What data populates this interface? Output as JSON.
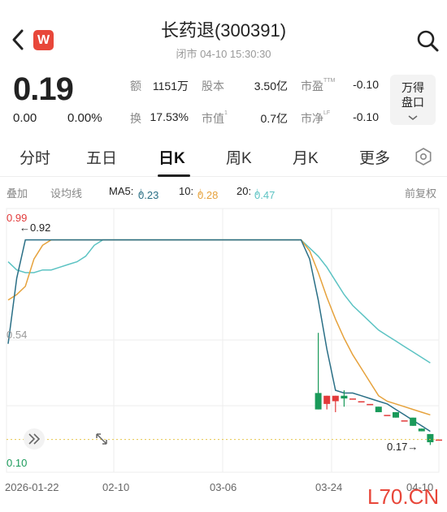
{
  "header": {
    "title": "长药退(300391)",
    "status": "闭市  04-10 15:30:30",
    "logo": "W",
    "back_icon": "chevron-left-icon",
    "search_icon": "search-icon"
  },
  "quote": {
    "price": "0.19",
    "change": "0.00",
    "change_pct": "0.00%",
    "amount_label": "额",
    "amount": "1151万",
    "turnover_label": "换",
    "turnover": "17.53%",
    "shares_label": "股本",
    "shares": "3.50亿",
    "mktcap_label": "市值",
    "mktcap_sup": "1",
    "mktcap": "0.7亿",
    "pe_label": "市盈",
    "pe_sup": "TTM",
    "pe": "-0.10",
    "pb_label": "市净",
    "pb_sup": "LF",
    "pb": "-0.10",
    "wd_line1": "万得",
    "wd_line2": "盘口",
    "wd_icon": "chevron-down-icon"
  },
  "tabs": {
    "items": [
      "分时",
      "五日",
      "日K",
      "周K",
      "月K",
      "更多"
    ],
    "active": "日K",
    "settings_icon": "gear-icon"
  },
  "indicators": {
    "overlay": "叠加",
    "set_ma": "设均线",
    "ma5_label": "MA5:",
    "ma5": "0.23",
    "ma10_label": "10:",
    "ma10": "0.28",
    "ma20_label": "20:",
    "ma20": "0.47",
    "adjust": "前复权",
    "colors": {
      "ma5": "#2a6f86",
      "ma10": "#e6a23c",
      "ma20": "#5cc3c3",
      "up": "#e23a3a",
      "down": "#1a9a5a"
    }
  },
  "chart_data": {
    "type": "candlestick",
    "y_labels": {
      "high": "0.99",
      "mid": "0.54",
      "low": "0.10"
    },
    "annotations": {
      "max": "0.92",
      "min": "0.17"
    },
    "x_labels": [
      "2026-01-22",
      "02-10",
      "03-06",
      "03-24",
      "04-10"
    ],
    "ylim": [
      0.1,
      0.99
    ],
    "last_close": 0.19,
    "ma5": [
      0.54,
      0.78,
      0.92,
      0.92,
      0.92,
      0.92,
      0.92,
      0.92,
      0.92,
      0.92,
      0.92,
      0.92,
      0.92,
      0.92,
      0.92,
      0.92,
      0.92,
      0.92,
      0.92,
      0.92,
      0.92,
      0.92,
      0.92,
      0.92,
      0.92,
      0.92,
      0.92,
      0.92,
      0.92,
      0.92,
      0.92,
      0.92,
      0.92,
      0.92,
      0.92,
      0.85,
      0.7,
      0.52,
      0.37,
      0.36,
      0.36,
      0.35,
      0.34,
      0.33,
      0.32,
      0.3,
      0.28,
      0.26,
      0.24,
      0.22
    ],
    "ma10": [
      0.7,
      0.72,
      0.75,
      0.85,
      0.9,
      0.92,
      0.92,
      0.92,
      0.92,
      0.92,
      0.92,
      0.92,
      0.92,
      0.92,
      0.92,
      0.92,
      0.92,
      0.92,
      0.92,
      0.92,
      0.92,
      0.92,
      0.92,
      0.92,
      0.92,
      0.92,
      0.92,
      0.92,
      0.92,
      0.92,
      0.92,
      0.92,
      0.92,
      0.92,
      0.92,
      0.88,
      0.8,
      0.71,
      0.63,
      0.56,
      0.5,
      0.45,
      0.4,
      0.35,
      0.33,
      0.32,
      0.31,
      0.3,
      0.29,
      0.28
    ],
    "ma20": [
      0.84,
      0.81,
      0.8,
      0.8,
      0.81,
      0.81,
      0.82,
      0.83,
      0.84,
      0.86,
      0.9,
      0.92,
      0.92,
      0.92,
      0.92,
      0.92,
      0.92,
      0.92,
      0.92,
      0.92,
      0.92,
      0.92,
      0.92,
      0.92,
      0.92,
      0.92,
      0.92,
      0.92,
      0.92,
      0.92,
      0.92,
      0.92,
      0.92,
      0.92,
      0.92,
      0.89,
      0.86,
      0.82,
      0.77,
      0.72,
      0.68,
      0.65,
      0.62,
      0.59,
      0.57,
      0.55,
      0.53,
      0.51,
      0.49,
      0.47
    ],
    "candles": [
      {
        "i": 36,
        "o": 0.36,
        "c": 0.3,
        "h": 0.58,
        "l": 0.3
      },
      {
        "i": 37,
        "o": 0.32,
        "c": 0.35,
        "h": 0.35,
        "l": 0.3
      },
      {
        "i": 38,
        "o": 0.33,
        "c": 0.35,
        "h": 0.35,
        "l": 0.29
      },
      {
        "i": 39,
        "o": 0.35,
        "c": 0.34,
        "h": 0.37,
        "l": 0.31
      },
      {
        "i": 40,
        "o": 0.34,
        "c": 0.34,
        "h": 0.34,
        "l": 0.34
      },
      {
        "i": 41,
        "o": 0.33,
        "c": 0.33,
        "h": 0.33,
        "l": 0.33
      },
      {
        "i": 42,
        "o": 0.32,
        "c": 0.32,
        "h": 0.32,
        "l": 0.32
      },
      {
        "i": 43,
        "o": 0.31,
        "c": 0.29,
        "h": 0.31,
        "l": 0.29
      },
      {
        "i": 44,
        "o": 0.28,
        "c": 0.28,
        "h": 0.28,
        "l": 0.28
      },
      {
        "i": 45,
        "o": 0.29,
        "c": 0.27,
        "h": 0.29,
        "l": 0.27
      },
      {
        "i": 46,
        "o": 0.26,
        "c": 0.26,
        "h": 0.26,
        "l": 0.26
      },
      {
        "i": 47,
        "o": 0.27,
        "c": 0.24,
        "h": 0.27,
        "l": 0.24
      },
      {
        "i": 48,
        "o": 0.23,
        "c": 0.22,
        "h": 0.23,
        "l": 0.22
      },
      {
        "i": 49,
        "o": 0.21,
        "c": 0.18,
        "h": 0.21,
        "l": 0.17
      },
      {
        "i": 50,
        "o": 0.19,
        "c": 0.19,
        "h": 0.19,
        "l": 0.19
      }
    ],
    "controls": {
      "expand_icon": "double-chevron-right-icon",
      "fullscreen_icon": "expand-arrows-icon"
    }
  },
  "watermark": "L70.CN"
}
